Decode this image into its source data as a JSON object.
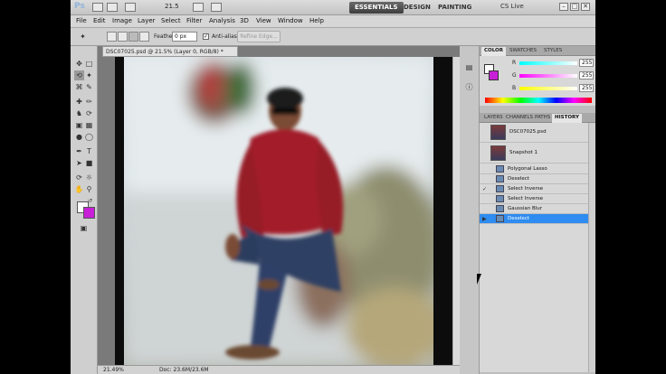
{
  "appbar": {
    "logo": "Ps",
    "zoom": "21.5",
    "workspaces": [
      "ESSENTIALS",
      "DESIGN",
      "PAINTING"
    ],
    "cs_live": "CS Live",
    "window_buttons": [
      "–",
      "□",
      "✕"
    ]
  },
  "menu": [
    "File",
    "Edit",
    "Image",
    "Layer",
    "Select",
    "Filter",
    "Analysis",
    "3D",
    "View",
    "Window",
    "Help"
  ],
  "options": {
    "feather_label": "Feather:",
    "feather_value": "0 px",
    "antialias_label": "Anti-alias",
    "refine_edge": "Refine Edge..."
  },
  "document": {
    "tab_title": "DSC07025.psd @ 21.5% (Layer 0, RGB/8) *",
    "close": "✕"
  },
  "status": {
    "zoom": "21.49%",
    "doc": "Doc: 23.6M/23.6M"
  },
  "color_panel": {
    "tabs": [
      "COLOR",
      "SWATCHES",
      "STYLES"
    ],
    "r_label": "R",
    "g_label": "G",
    "b_label": "B",
    "r": "255",
    "g": "255",
    "b": "255"
  },
  "history_panel": {
    "tabs": [
      "LAYERS",
      "CHANNELS",
      "PATHS",
      "HISTORY"
    ],
    "snapshots": [
      "DSC07025.psd",
      "Snapshot 1"
    ],
    "states": [
      "Polygonal Lasso",
      "Deselect",
      "Select Inverse",
      "Select Inverse",
      "Gaussian Blur",
      "Deselect"
    ],
    "selected_index": 5
  },
  "colors": {
    "foreground": "#ffffff",
    "background": "#c81ed8",
    "highlight": "#2f8cf0"
  }
}
